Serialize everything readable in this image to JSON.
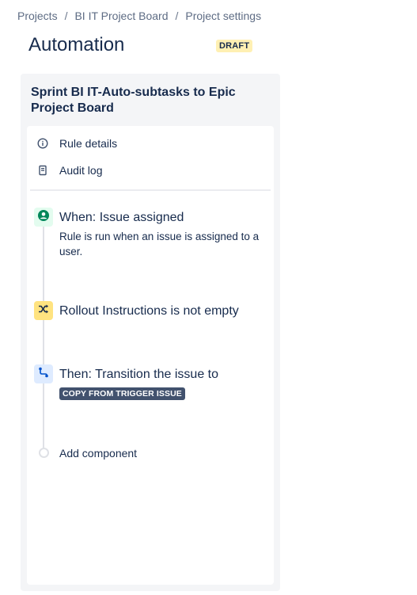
{
  "breadcrumb": {
    "items": [
      "Projects",
      "BI IT Project Board",
      "Project settings"
    ],
    "separator": "/"
  },
  "page": {
    "title": "Automation",
    "status_badge": "DRAFT"
  },
  "rule": {
    "name": "Sprint BI IT-Auto-subtasks to Epic Project Board"
  },
  "menu": {
    "rule_details": "Rule details",
    "audit_log": "Audit log"
  },
  "components": {
    "trigger": {
      "title": "When: Issue assigned",
      "description": "Rule is run when an issue is assigned to a user.",
      "icon": "user-circle-icon",
      "color": "#00875a"
    },
    "condition": {
      "title": "Rollout Instructions is not empty",
      "icon": "shuffle-icon",
      "color": "#ffe380"
    },
    "action": {
      "title": "Then: Transition the issue to",
      "tag": "COPY FROM TRIGGER ISSUE",
      "icon": "transition-icon",
      "color": "#0052cc"
    },
    "add_component": "Add component"
  },
  "colors": {
    "panel_bg": "#f4f5f7",
    "badge_bg": "#fff0b3",
    "tag_bg": "#42526e",
    "text": "#172b4d"
  }
}
